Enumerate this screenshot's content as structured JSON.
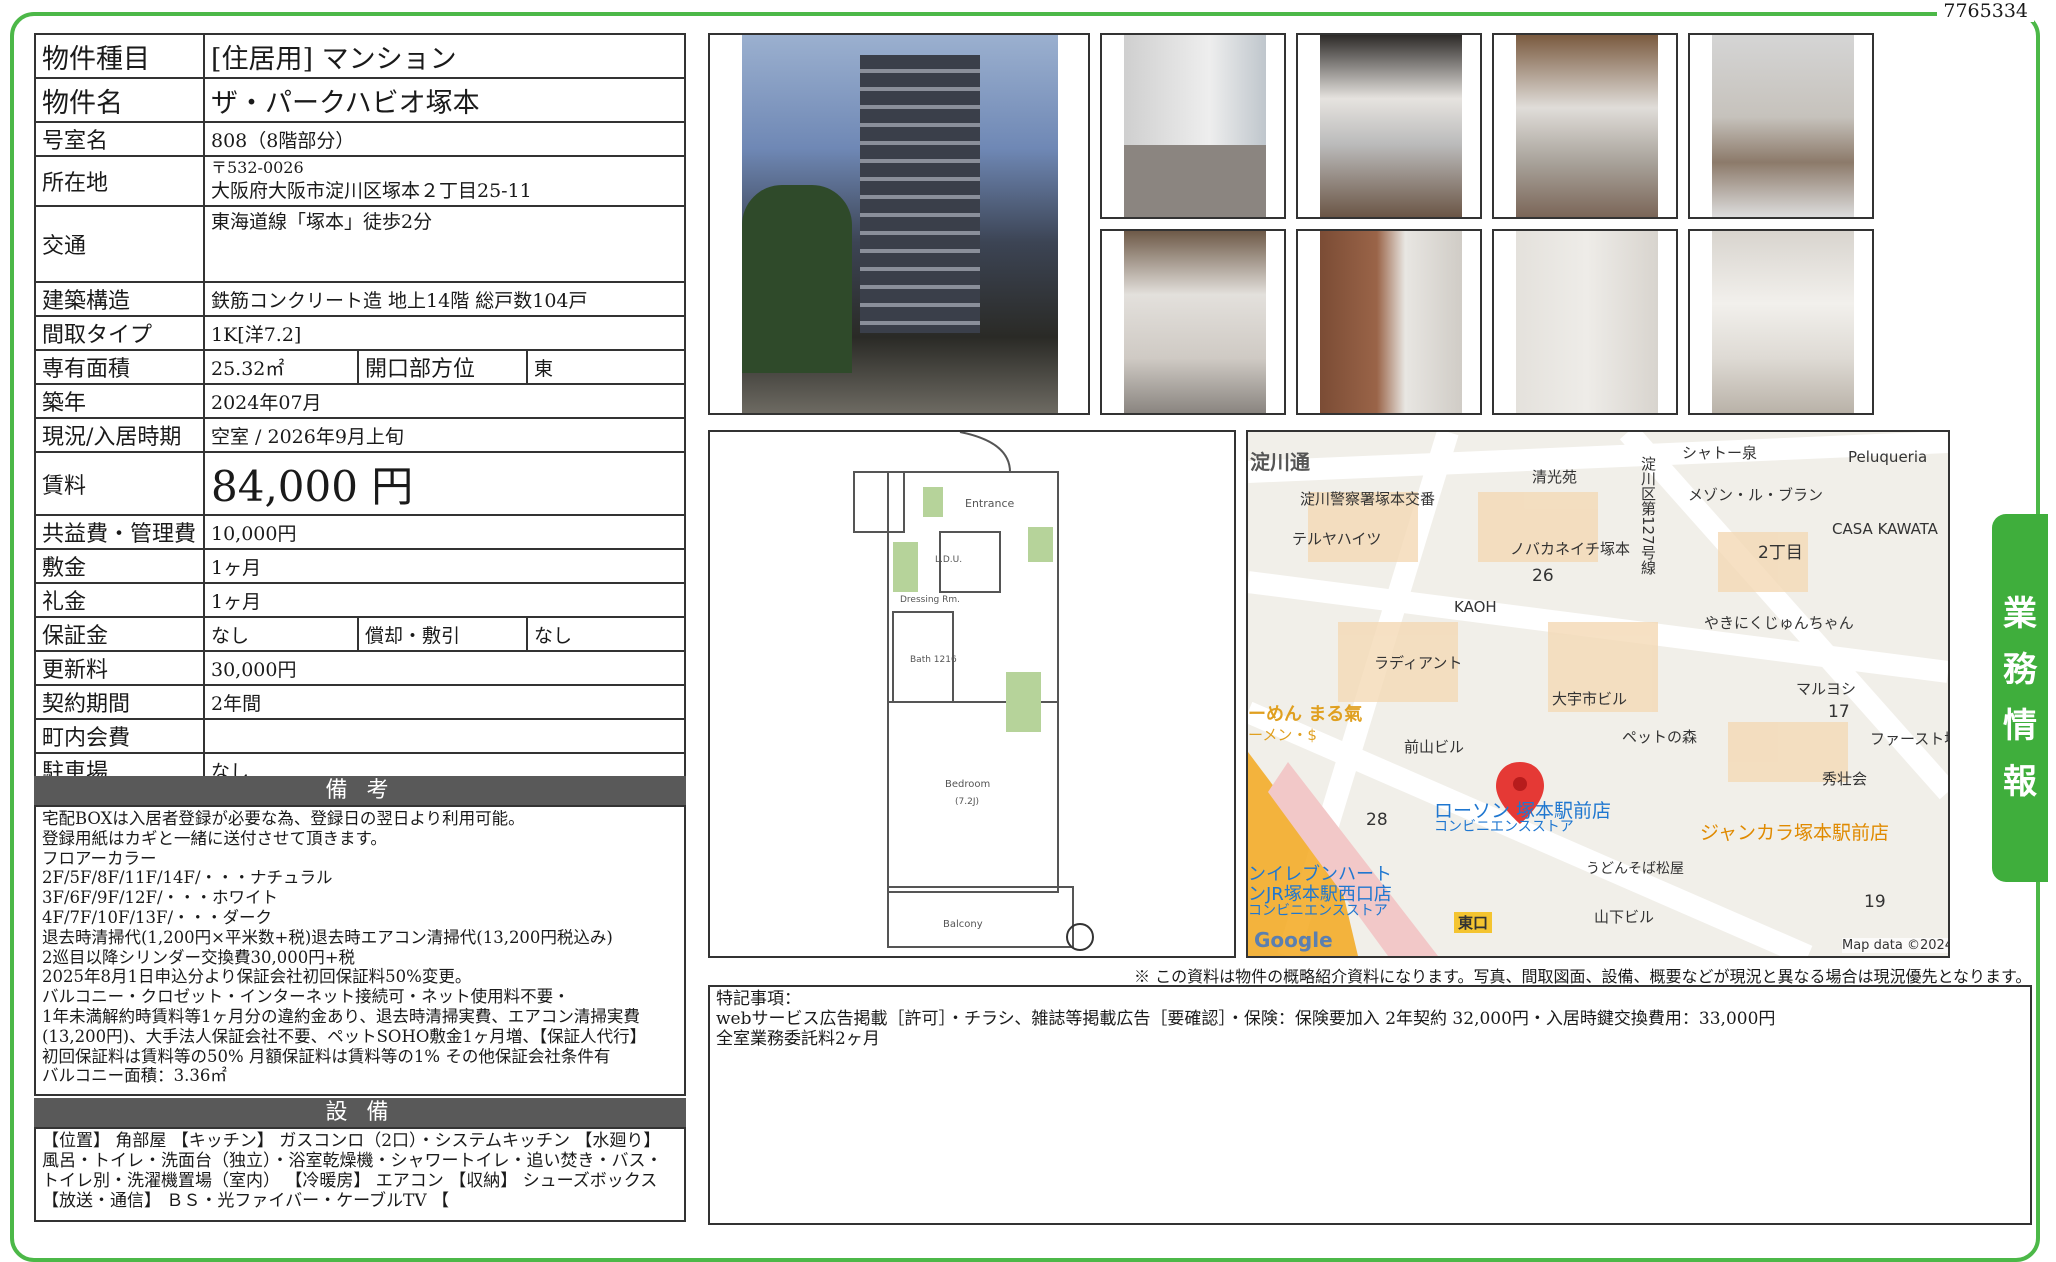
{
  "doc_id": "7765334",
  "side_tab": [
    "業",
    "務",
    "情",
    "報"
  ],
  "rows": [
    {
      "k": "物件種目",
      "v": "[住居用]  マンション"
    },
    {
      "k": "物件名",
      "v": "ザ・パークハビオ塚本"
    },
    {
      "k": "号室名",
      "v": "808（8階部分）"
    },
    {
      "k": "所在地",
      "v_small": "〒532-0026",
      "v": "大阪府大阪市淀川区塚本２丁目25-11"
    },
    {
      "k": "交通",
      "v": "東海道線「塚本」徒歩2分"
    },
    {
      "k": "建築構造",
      "v": "鉄筋コンクリート造 地上14階 総戸数104戸"
    },
    {
      "k": "間取タイプ",
      "v": "1K[洋7.2]"
    },
    {
      "k": "専有面積",
      "v": "25.32㎡",
      "k2": "開口部方位",
      "v2": "東"
    },
    {
      "k": "築年",
      "v": "2024年07月"
    },
    {
      "k": "現況/入居時期",
      "v": "空室 /  2026年9月上旬"
    },
    {
      "k": "賃料",
      "v": "84,000 円"
    },
    {
      "k": "共益費・管理費",
      "v": "10,000円"
    },
    {
      "k": "敷金",
      "v": "1ヶ月"
    },
    {
      "k": "礼金",
      "v": "1ヶ月"
    },
    {
      "k": "保証金",
      "v": "なし",
      "k2": "償却・敷引",
      "v2": "なし"
    },
    {
      "k": "更新料",
      "v": "30,000円"
    },
    {
      "k": "契約期間",
      "v": "2年間"
    },
    {
      "k": "町内会費",
      "v": ""
    },
    {
      "k": "駐車場",
      "v": "なし"
    }
  ],
  "biko_title": "備 考",
  "biko_text": "宅配BOXは入居者登録が必要な為、登録日の翌日より利用可能。\n登録用紙はカギと一緒に送付させて頂きます。\nフロアーカラー\n2F/5F/8F/11F/14F/・・・ナチュラル\n3F/6F/9F/12F/・・・ホワイト\n4F/7F/10F/13F/・・・ダーク\n退去時清掃代(1,200円×平米数+税)退去時エアコン清掃代(13,200円税込み)\n2巡目以降シリンダー交換費30,000円+税\n2025年8月1日申込分より保証会社初回保証料50%変更。\nバルコニー・クロゼット・インターネット接続可・ネット使用料不要・\n1年未満解約時賃料等1ヶ月分の違約金あり、退去時清掃実費、エアコン清掃実費\n(13,200円)、大手法人保証会社不要、ペットSOHO敷金1ヶ月増、【保証人代行】\n初回保証料は賃料等の50% 月額保証料は賃料等の1% その他保証会社条件有\nバルコニー面積：3.36㎡",
  "setsubi_title": "設 備",
  "setsubi_text": "【位置】 角部屋 【キッチン】 ガスコンロ（2口）・システムキッチン 【水廻り】 風呂・トイレ・洗面台（独立）・浴室乾燥機・シャワートイレ・追い焚き・バス・トイレ別・洗濯機置場（室内） 【冷暖房】 エアコン 【収納】 シューズボックス 【放送・通信】 ＢＳ・光ファイバー・ケーブルTV 【",
  "plan_labels": {
    "entrance": "Entrance",
    "ldu": "L.D.U.",
    "dressing": "Dressing Rm.",
    "bath": "Bath 1216",
    "bedroom": "Bedroom",
    "bedroom_size": "(7.2J)",
    "balcony": "Balcony"
  },
  "map_labels": [
    "淀川通",
    "淀川警察署塚本交番",
    "清光苑",
    "シャトー泉",
    "Peluqueria",
    "メゾン・ル・ブラン",
    "CASA KAWATA",
    "テルヤハイツ",
    "ノバカネイチ塚本",
    "26",
    "2丁目",
    "淀川区第127号線",
    "KAOH",
    "やきにくじゅんちゃん",
    "ラディアント",
    "大宇市ビル",
    "マルヨシ",
    "17",
    "ファースト塚",
    "ーめん まる氣",
    "ーメン・$",
    "前山ビル",
    "ペットの森",
    "秀壮会",
    "28",
    "ローソン 塚本駅前店",
    "コンビニエンスストア",
    "ジャンカラ塚本駅前店",
    "うどんそば松屋",
    "ンイレブンハート",
    "ンJR塚本駅西口店",
    "コンビニエンスストア",
    "東口",
    "山下ビル",
    "19",
    "Google",
    "Map data ©2024"
  ],
  "note": "※ この資料は物件の概略紹介資料になります。写真、間取図面、設備、概要などが現況と異なる場合は現況優先となります。",
  "tokki_text": "特記事項：\nwebサービス広告掲載［許可］・チラシ、雑誌等掲載広告［要確認］・保険：保険要加入 2年契約 32,000円・入居時鍵交換費用：33,000円\n全室業務委託料2ヶ月"
}
